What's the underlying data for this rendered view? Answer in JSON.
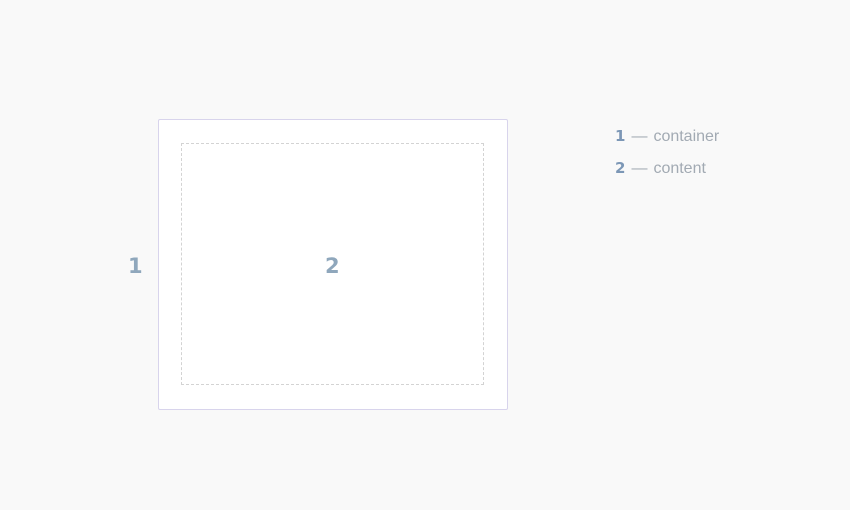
{
  "diagram": {
    "markers": {
      "outer": "1",
      "inner": "2"
    },
    "legend": [
      {
        "number": "1",
        "separator": "—",
        "label": "container"
      },
      {
        "number": "2",
        "separator": "—",
        "label": "content"
      }
    ]
  },
  "colors": {
    "background": "#f9f9f9",
    "container_border": "#d8d4ec",
    "content_border": "#d3d3d3",
    "marker": "#8fa7bc",
    "legend_number": "#7c97b6",
    "legend_text": "#a2aab3"
  }
}
